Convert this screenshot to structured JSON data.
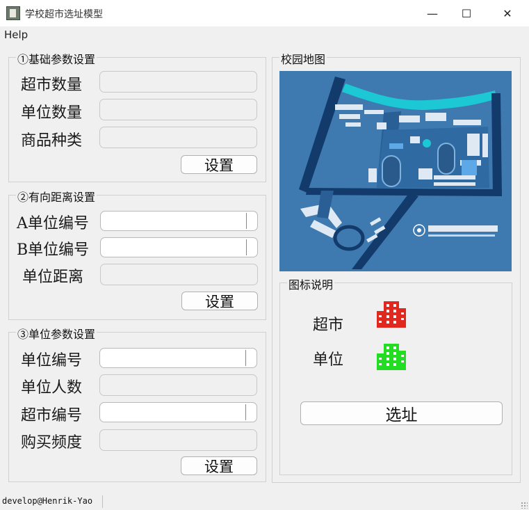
{
  "window": {
    "title": "学校超市选址模型",
    "minimize": "—",
    "maximize": "☐",
    "close": "✕"
  },
  "menu": {
    "help": "Help"
  },
  "basic": {
    "title": "①基础参数设置",
    "supermarket_count_label": "超市数量",
    "unit_count_label": "单位数量",
    "goods_types_label": "商品种类",
    "set_button": "设置"
  },
  "distance": {
    "title": "②有向距离设置",
    "unit_a_label": "A单位编号",
    "unit_b_label": "B单位编号",
    "distance_label": "单位距离",
    "set_button": "设置"
  },
  "unit": {
    "title": "③单位参数设置",
    "unit_id_label": "单位编号",
    "people_label": "单位人数",
    "supermarket_id_label": "超市编号",
    "frequency_label": "购买频度",
    "set_button": "设置"
  },
  "map": {
    "title": "校园地图"
  },
  "legend": {
    "title": "图标说明",
    "supermarket_label": "超市",
    "unit_label": "单位",
    "supermarket_color": "#e0281e",
    "unit_color": "#22dd22"
  },
  "select_button": "选址",
  "status": {
    "text": "develop@Henrik-Yao"
  }
}
